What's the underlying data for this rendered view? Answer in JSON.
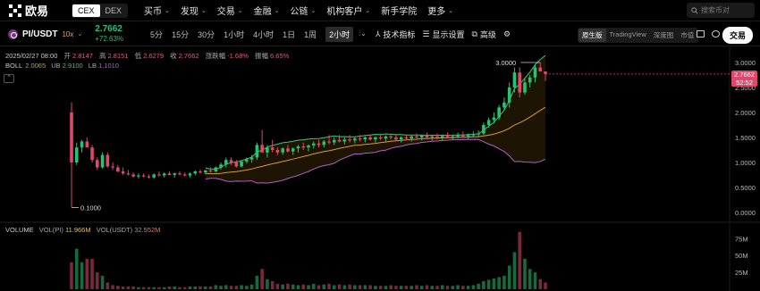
{
  "nav": {
    "logo_text": "欧易",
    "segments": [
      {
        "label": "CEX",
        "active": true
      },
      {
        "label": "DEX",
        "active": false
      }
    ],
    "menu": [
      "买币",
      "发现",
      "交易",
      "金融",
      "公链",
      "机构客户",
      "新手学院",
      "更多"
    ],
    "search_placeholder": "搜索币对"
  },
  "pair": {
    "symbol": "PI/USDT",
    "leverage": "10x",
    "price": "2.7662",
    "change": "+72.63%",
    "intervals": [
      "5分",
      "15分",
      "30分",
      "1小时",
      "4小时",
      "1日",
      "1周",
      "2小时"
    ],
    "active_interval": "2小时",
    "tools": [
      "技术指标",
      "显示设置",
      "高级"
    ],
    "views": [
      "原生版",
      "TradingView",
      "深度图",
      "市值"
    ],
    "active_view": "原生版",
    "trade_button": "交易"
  },
  "legend": {
    "datetime": "2025/02/27 08:00",
    "open_label": "开",
    "open": "2.8147",
    "high_label": "高",
    "high": "2.8151",
    "low_label": "低",
    "low": "2.6279",
    "close_label": "收",
    "close": "2.7662",
    "chg_label": "涨跌幅",
    "chg": "-1.68%",
    "amp_label": "振幅",
    "amp": "6.65%",
    "boll_label": "BOLL",
    "boll_mid": "2.0065",
    "ub_label": "UB",
    "ub": "2.9100",
    "lb_label": "LB",
    "lb": "1.1010"
  },
  "volume": {
    "label": "VOLUME",
    "pi_label": "VOL(PI)",
    "pi": "11.966M",
    "usdt_label": "VOL(USDT)",
    "usdt": "32.552M"
  },
  "current_tag": {
    "price": "2.7662",
    "countdown": "52:52"
  },
  "colors": {
    "up": "#25c46e",
    "down": "#e0476f",
    "mid": "#d89b2c",
    "upper": "#3cc67a",
    "lower": "#b160c8"
  },
  "chart_data": {
    "type": "candlestick",
    "price_axis": {
      "ticks": [
        "3.0000",
        "2.5000",
        "2.0000",
        "1.5000",
        "1.0000",
        "0.5000",
        "0.0000"
      ],
      "min": 0,
      "max": 3.0
    },
    "volume_axis": {
      "ticks": [
        "75M",
        "50M",
        "25M"
      ],
      "max": 90
    },
    "annotations": {
      "high": "3.0000",
      "low": "0.1000"
    },
    "candles": [
      [
        2.0,
        2.2,
        0.1,
        1.0,
        40
      ],
      [
        1.0,
        1.4,
        0.95,
        1.3,
        60
      ],
      [
        1.3,
        1.45,
        1.2,
        1.42,
        40
      ],
      [
        1.42,
        1.5,
        1.3,
        1.3,
        45
      ],
      [
        1.3,
        1.35,
        1.0,
        1.05,
        45
      ],
      [
        1.05,
        1.1,
        0.85,
        0.9,
        25
      ],
      [
        0.9,
        1.2,
        0.88,
        1.15,
        20
      ],
      [
        1.15,
        1.2,
        0.9,
        0.92,
        10
      ],
      [
        0.92,
        1.0,
        0.85,
        0.9,
        6
      ],
      [
        0.9,
        0.95,
        0.8,
        0.82,
        5
      ],
      [
        0.82,
        0.9,
        0.75,
        0.78,
        4
      ],
      [
        0.78,
        0.85,
        0.74,
        0.76,
        4
      ],
      [
        0.76,
        0.8,
        0.7,
        0.72,
        4
      ],
      [
        0.72,
        0.78,
        0.68,
        0.74,
        3
      ],
      [
        0.74,
        0.78,
        0.7,
        0.72,
        3
      ],
      [
        0.72,
        0.76,
        0.68,
        0.7,
        3
      ],
      [
        0.7,
        0.78,
        0.68,
        0.76,
        3
      ],
      [
        0.76,
        0.82,
        0.72,
        0.74,
        3
      ],
      [
        0.74,
        0.8,
        0.7,
        0.78,
        3
      ],
      [
        0.78,
        0.82,
        0.74,
        0.75,
        4
      ],
      [
        0.75,
        0.8,
        0.7,
        0.78,
        4
      ],
      [
        0.78,
        0.82,
        0.74,
        0.76,
        3
      ],
      [
        0.76,
        0.8,
        0.72,
        0.74,
        3
      ],
      [
        0.74,
        0.8,
        0.7,
        0.78,
        4
      ],
      [
        0.78,
        0.84,
        0.74,
        0.82,
        4
      ],
      [
        0.82,
        0.86,
        0.78,
        0.8,
        4
      ],
      [
        0.8,
        0.85,
        0.76,
        0.84,
        4
      ],
      [
        0.84,
        0.9,
        0.8,
        0.82,
        4
      ],
      [
        0.82,
        0.92,
        0.8,
        0.9,
        6
      ],
      [
        0.9,
        1.0,
        0.86,
        0.96,
        5
      ],
      [
        0.96,
        1.1,
        0.9,
        1.05,
        6
      ],
      [
        1.05,
        1.1,
        0.95,
        1.0,
        5
      ],
      [
        1.0,
        1.05,
        0.9,
        0.92,
        5
      ],
      [
        0.92,
        1.05,
        0.9,
        1.02,
        6
      ],
      [
        1.02,
        1.1,
        0.98,
        1.06,
        5
      ],
      [
        1.06,
        1.15,
        1.0,
        1.1,
        7
      ],
      [
        1.1,
        1.4,
        1.05,
        1.35,
        20
      ],
      [
        1.35,
        1.65,
        1.3,
        1.2,
        30
      ],
      [
        1.2,
        1.35,
        1.1,
        1.3,
        15
      ],
      [
        1.3,
        1.45,
        1.2,
        1.25,
        12
      ],
      [
        1.25,
        1.3,
        1.15,
        1.2,
        8
      ],
      [
        1.2,
        1.3,
        1.15,
        1.28,
        7
      ],
      [
        1.28,
        1.35,
        1.2,
        1.22,
        8
      ],
      [
        1.22,
        1.3,
        1.15,
        1.28,
        7
      ],
      [
        1.28,
        1.35,
        1.2,
        1.32,
        6
      ],
      [
        1.32,
        1.4,
        1.25,
        1.3,
        7
      ],
      [
        1.3,
        1.36,
        1.22,
        1.34,
        6
      ],
      [
        1.34,
        1.42,
        1.28,
        1.38,
        8
      ],
      [
        1.38,
        1.45,
        1.3,
        1.35,
        6
      ],
      [
        1.35,
        1.45,
        1.3,
        1.42,
        7
      ],
      [
        1.42,
        1.55,
        1.36,
        1.4,
        8
      ],
      [
        1.4,
        1.5,
        1.35,
        1.45,
        6
      ],
      [
        1.45,
        1.55,
        1.4,
        1.42,
        7
      ],
      [
        1.42,
        1.5,
        1.36,
        1.46,
        6
      ],
      [
        1.46,
        1.55,
        1.4,
        1.44,
        7
      ],
      [
        1.44,
        1.5,
        1.38,
        1.48,
        6
      ],
      [
        1.48,
        1.55,
        1.42,
        1.46,
        6
      ],
      [
        1.46,
        1.52,
        1.4,
        1.5,
        6
      ],
      [
        1.5,
        1.56,
        1.44,
        1.46,
        6
      ],
      [
        1.46,
        1.52,
        1.4,
        1.5,
        5
      ],
      [
        1.5,
        1.56,
        1.45,
        1.48,
        5
      ],
      [
        1.48,
        1.54,
        1.42,
        1.52,
        5
      ],
      [
        1.52,
        1.58,
        1.46,
        1.5,
        6
      ],
      [
        1.5,
        1.56,
        1.44,
        1.46,
        5
      ],
      [
        1.46,
        1.52,
        1.4,
        1.5,
        5
      ],
      [
        1.5,
        1.55,
        1.44,
        1.48,
        5
      ],
      [
        1.48,
        1.54,
        1.42,
        1.52,
        5
      ],
      [
        1.52,
        1.58,
        1.46,
        1.5,
        6
      ],
      [
        1.5,
        1.56,
        1.44,
        1.54,
        5
      ],
      [
        1.54,
        1.6,
        1.48,
        1.5,
        6
      ],
      [
        1.5,
        1.56,
        1.44,
        1.52,
        5
      ],
      [
        1.52,
        1.58,
        1.46,
        1.5,
        5
      ],
      [
        1.5,
        1.56,
        1.44,
        1.53,
        6
      ],
      [
        1.53,
        1.6,
        1.48,
        1.5,
        5
      ],
      [
        1.5,
        1.56,
        1.45,
        1.52,
        5
      ],
      [
        1.52,
        1.6,
        1.48,
        1.55,
        6
      ],
      [
        1.55,
        1.62,
        1.5,
        1.52,
        5
      ],
      [
        1.52,
        1.58,
        1.46,
        1.55,
        5
      ],
      [
        1.55,
        1.62,
        1.5,
        1.56,
        6
      ],
      [
        1.56,
        1.64,
        1.5,
        1.58,
        8
      ],
      [
        1.58,
        1.8,
        1.55,
        1.75,
        12
      ],
      [
        1.75,
        1.9,
        1.7,
        1.85,
        14
      ],
      [
        1.85,
        2.0,
        1.78,
        1.9,
        16
      ],
      [
        1.9,
        2.15,
        1.85,
        2.1,
        18
      ],
      [
        2.1,
        2.3,
        2.05,
        2.2,
        20
      ],
      [
        2.2,
        2.6,
        2.1,
        2.5,
        35
      ],
      [
        2.5,
        2.9,
        2.4,
        2.8,
        55
      ],
      [
        2.8,
        2.9,
        2.3,
        2.4,
        85
      ],
      [
        2.4,
        2.7,
        2.35,
        2.6,
        45
      ],
      [
        2.6,
        2.75,
        2.5,
        2.7,
        30
      ],
      [
        2.7,
        2.95,
        2.6,
        2.9,
        25
      ],
      [
        2.9,
        3.0,
        2.85,
        2.82,
        15
      ],
      [
        2.82,
        2.82,
        2.63,
        2.77,
        10
      ]
    ]
  }
}
